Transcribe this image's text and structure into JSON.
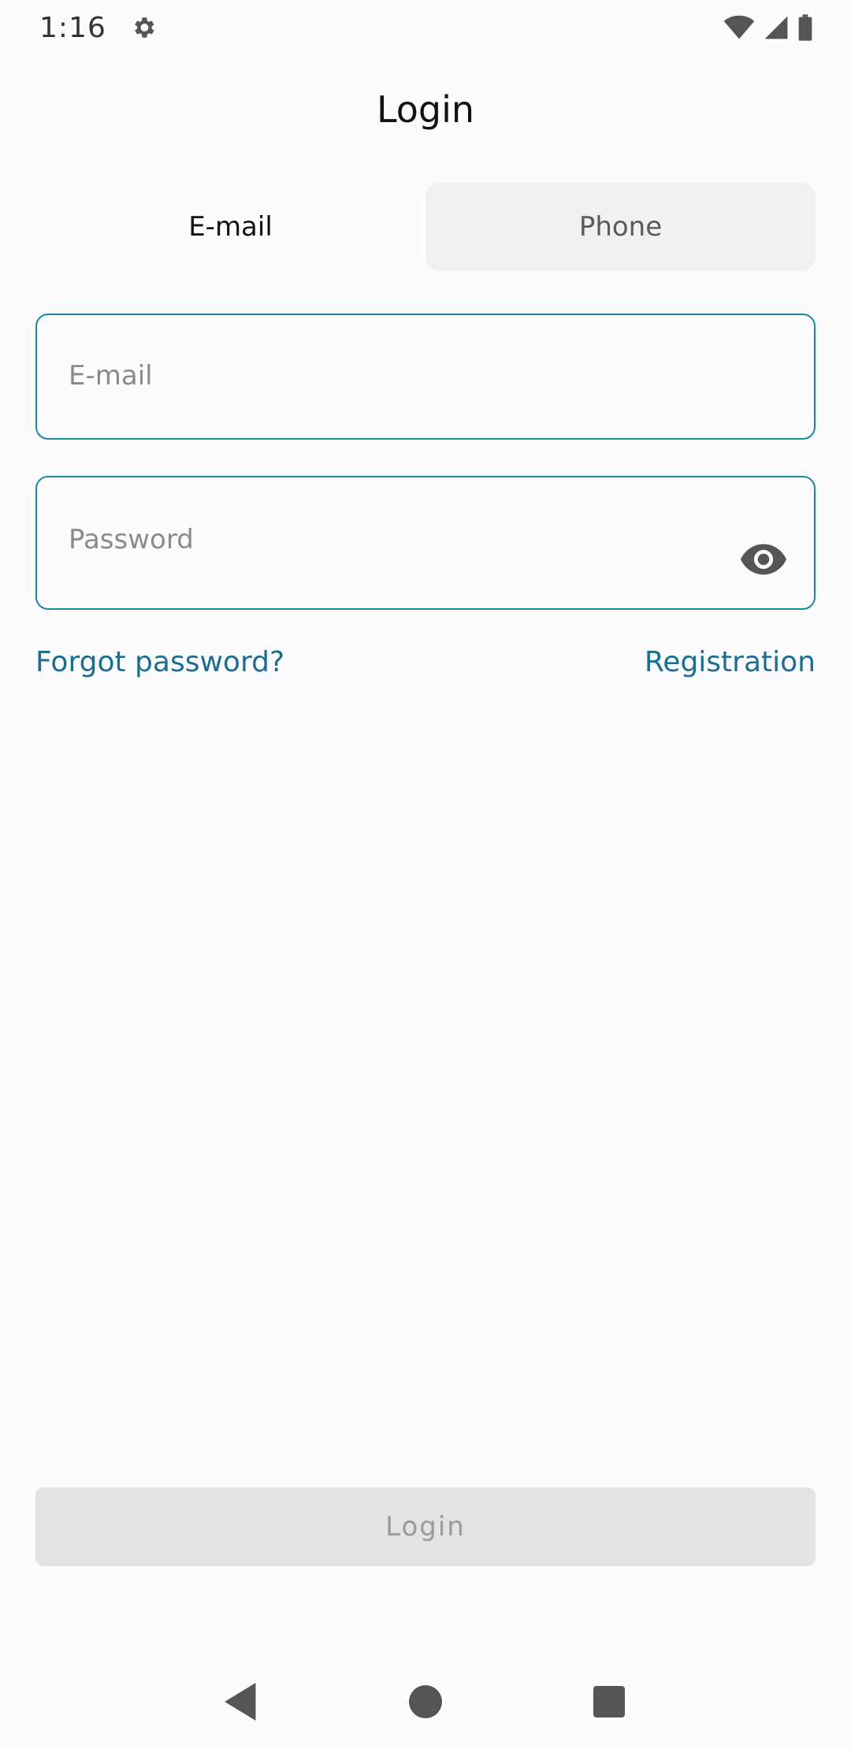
{
  "status_bar": {
    "time": "1:16",
    "icons": [
      "gear-icon",
      "wifi-icon",
      "signal-icon",
      "battery-icon"
    ]
  },
  "page": {
    "title": "Login"
  },
  "tabs": [
    {
      "label": "E-mail",
      "active": true
    },
    {
      "label": "Phone",
      "active": false
    }
  ],
  "form": {
    "email": {
      "value": "",
      "placeholder": "E-mail"
    },
    "password": {
      "value": "",
      "placeholder": "Password"
    },
    "forgot_password": "Forgot password?",
    "registration": "Registration",
    "login_button": "Login"
  },
  "nav_bar": {
    "icons": [
      "back-icon",
      "home-icon",
      "recents-icon"
    ]
  },
  "colors": {
    "accent": "#1a86a8",
    "link": "#1a6e92",
    "disabled_button": "#e3e3e5",
    "background": "#fcfcfe"
  }
}
